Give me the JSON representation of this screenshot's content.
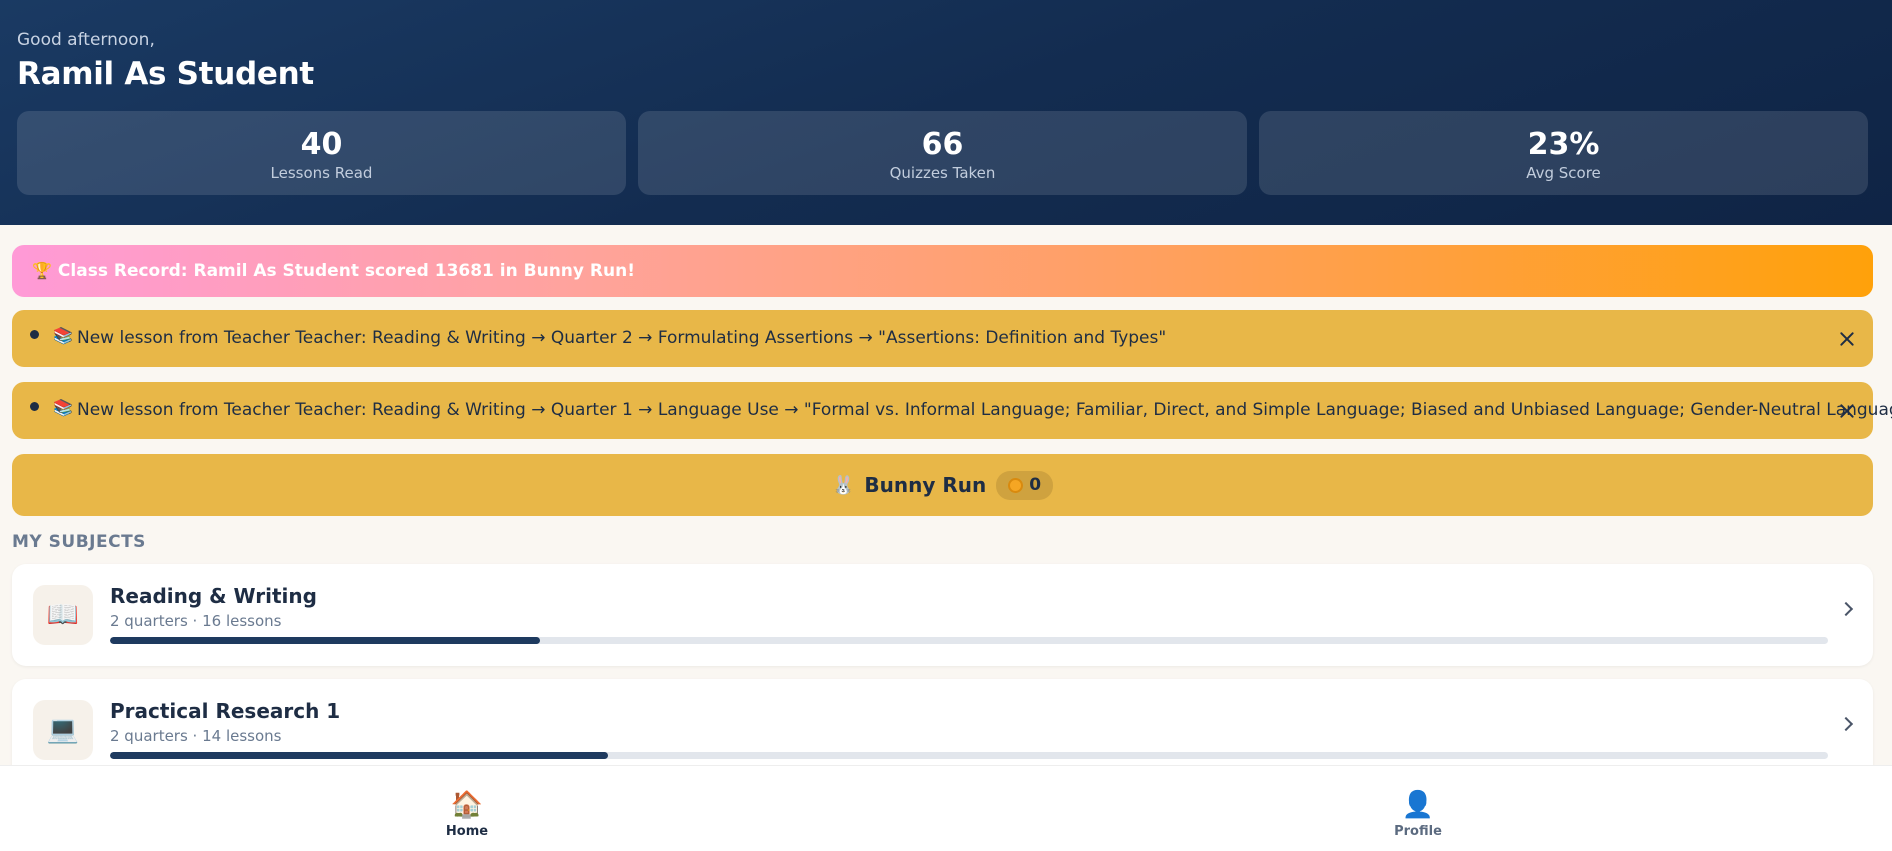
{
  "header": {
    "greeting": "Good afternoon,",
    "username": "Ramil As Student"
  },
  "stats": [
    {
      "value": "40",
      "label": "Lessons Read"
    },
    {
      "value": "66",
      "label": "Quizzes Taken"
    },
    {
      "value": "23%",
      "label": "Avg Score"
    }
  ],
  "record_banner": {
    "icon": "trophy-icon",
    "text": "Class Record: Ramil As Student scored 13681 in Bunny Run!"
  },
  "notifications": [
    {
      "icon": "books-icon",
      "text": "New lesson from Teacher Teacher: Reading & Writing → Quarter 2 → Formulating Assertions → \"Assertions: Definition and Types\""
    },
    {
      "icon": "books-icon",
      "text": "New lesson from Teacher Teacher: Reading & Writing → Quarter 1 → Language Use → \"Formal vs. Informal Language; Familiar, Direct, and Simple Language; Biased and Unbiased Language; Gender-Neutral Language\""
    }
  ],
  "game": {
    "icon": "bunny-icon",
    "label": "Bunny Run",
    "coins": "0"
  },
  "subjects_section": {
    "title": "MY SUBJECTS"
  },
  "subjects": [
    {
      "icon": "open-book-icon",
      "name": "Reading & Writing",
      "meta": "2 quarters · 16 lessons",
      "progress": 0.25
    },
    {
      "icon": "laptop-icon",
      "name": "Practical Research 1",
      "meta": "2 quarters · 14 lessons",
      "progress": 0.29
    }
  ],
  "bottom_nav": [
    {
      "icon": "house-icon",
      "label": "Home",
      "active": true
    },
    {
      "icon": "person-icon",
      "label": "Profile",
      "active": false
    }
  ],
  "colors": {
    "header_bg": "#132c50",
    "notice_bg": "#e8b748",
    "progress_fill": "#1e3a5f",
    "page_bg": "#faf7f2"
  }
}
